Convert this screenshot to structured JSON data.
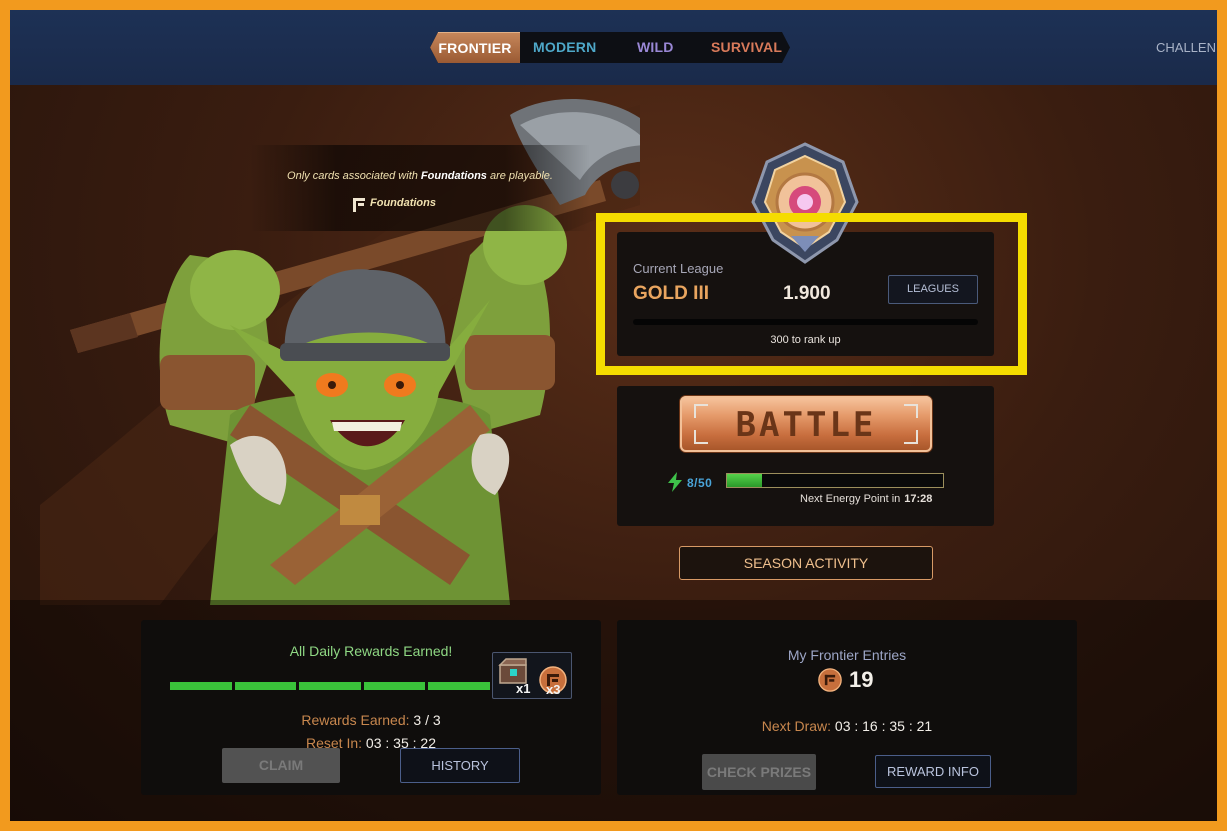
{
  "nav": {
    "tabs": [
      {
        "label": "FRONTIER",
        "active": true,
        "color": "#ffffff"
      },
      {
        "label": "MODERN",
        "active": false,
        "color": "#4ea8c9"
      },
      {
        "label": "WILD",
        "active": false,
        "color": "#9a88d6"
      },
      {
        "label": "SURVIVAL",
        "active": false,
        "color": "#d87a5a"
      }
    ],
    "right_link": "CHALLEN"
  },
  "notice": {
    "prefix": "Only cards associated with ",
    "set_name": "Foundations",
    "suffix": " are playable.",
    "set_label": "Foundations",
    "set_icon": "foundations-set-icon"
  },
  "league": {
    "label": "Current League",
    "name": "GOLD III",
    "rating": "1.900",
    "leagues_button": "LEAGUES",
    "rank_progress_fraction": 0.0,
    "rank_up_text": "300 to rank up",
    "emblem_icon": "gold-league-emblem-icon",
    "highlight_color": "#f5dc00"
  },
  "battle": {
    "button_label": "BATTLE",
    "energy_text": "8/50",
    "energy_current": 8,
    "energy_max": 50,
    "next_energy_label": "Next Energy Point in",
    "next_energy_time": "17:28",
    "season_activity_button": "SEASON ACTIVITY"
  },
  "daily": {
    "title": "All Daily Rewards Earned!",
    "segments_total": 5,
    "segments_filled": 5,
    "rewards": [
      {
        "icon": "reward-chest-icon",
        "qty": "x1"
      },
      {
        "icon": "frontier-ticket-icon",
        "qty": "x3"
      }
    ],
    "earned_label": "Rewards Earned:",
    "earned_value": "3 / 3",
    "reset_label": "Reset In:",
    "reset_value": "03 : 35 : 22",
    "claim_button": "CLAIM",
    "history_button": "HISTORY"
  },
  "entries": {
    "title": "My Frontier Entries",
    "count": "19",
    "ticket_icon": "frontier-ticket-icon",
    "next_draw_label": "Next Draw:",
    "next_draw_value": "03 : 16 : 35 : 21",
    "check_prizes_button": "CHECK PRIZES",
    "reward_info_button": "REWARD INFO"
  },
  "colors": {
    "accent_orange": "#e9a55f",
    "success_green": "#3ac23a",
    "energy_blue": "#4aa4d8",
    "frame_orange": "#f29a1e"
  }
}
